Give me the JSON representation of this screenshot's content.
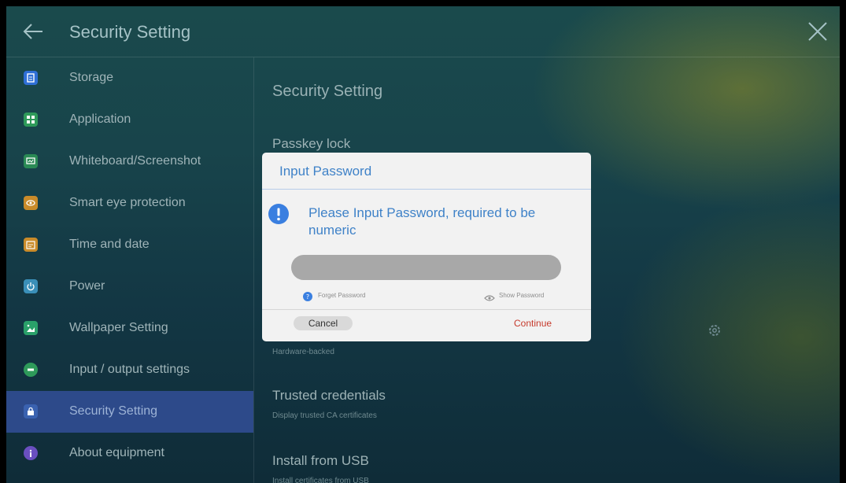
{
  "header": {
    "title": "Security Setting",
    "back_icon": "back-arrow-icon",
    "close_icon": "close-icon"
  },
  "sidebar": {
    "items": [
      {
        "label": "Storage",
        "icon": "storage-icon",
        "color": "#2f6fd6"
      },
      {
        "label": "Application",
        "icon": "application-icon",
        "color": "#2e9a5a"
      },
      {
        "label": "Whiteboard/Screenshot",
        "icon": "whiteboard-icon",
        "color": "#2a8a55"
      },
      {
        "label": "Smart eye protection",
        "icon": "eye-protection-icon",
        "color": "#c98b2a"
      },
      {
        "label": "Time and date",
        "icon": "calendar-icon",
        "color": "#c98b2a"
      },
      {
        "label": "Power",
        "icon": "power-icon",
        "color": "#3a8fb8"
      },
      {
        "label": "Wallpaper Setting",
        "icon": "wallpaper-icon",
        "color": "#2aa06a"
      },
      {
        "label": "Input / output settings",
        "icon": "input-output-icon",
        "color": "#2e9a5a"
      },
      {
        "label": "Security Setting",
        "icon": "lock-icon",
        "color": "#3a62b0",
        "active": true
      },
      {
        "label": "About equipment",
        "icon": "info-icon",
        "color": "#6a4fc0"
      }
    ]
  },
  "content": {
    "title": "Security Setting",
    "passkey": "Passkey lock",
    "storage_type_sub": "Hardware-backed",
    "trusted_title": "Trusted credentials",
    "trusted_sub": "Display trusted CA certificates",
    "usb_title": "Install from USB",
    "usb_sub": "Install certificates from USB"
  },
  "dialog": {
    "title": "Input Password",
    "message": "Please Input Password, required to be numeric",
    "password_value": "",
    "forget": "Forget Password",
    "show": "Show Password",
    "cancel": "Cancel",
    "continue": "Continue"
  },
  "colors": {
    "accent_blue": "#3f82c8",
    "continue_red": "#c63a2c",
    "active_item": "#2d4a8a"
  }
}
